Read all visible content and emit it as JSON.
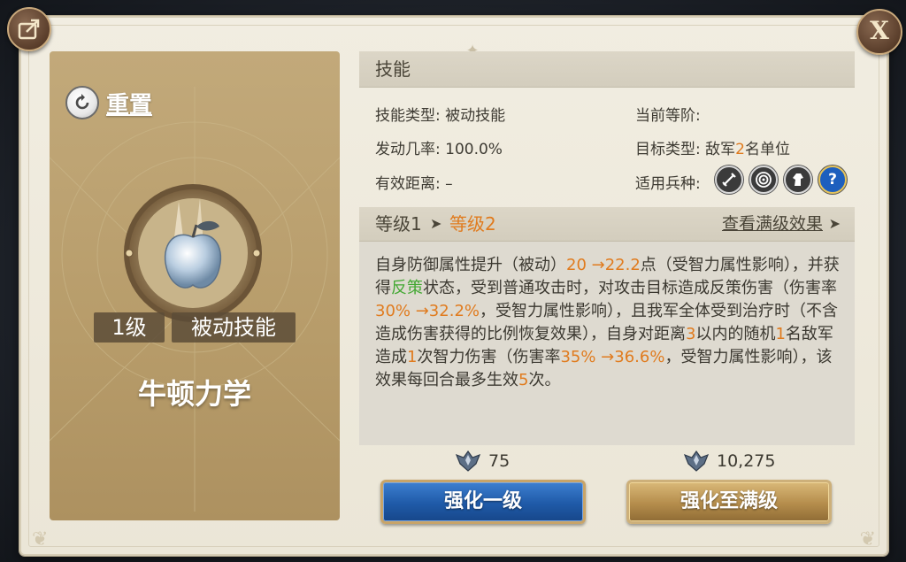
{
  "header": {
    "title": "技能"
  },
  "actions": {
    "share_icon": "share-export-icon",
    "close_label": "X"
  },
  "skill": {
    "reset_label": "重置",
    "level_tag": "1级",
    "type_tag": "被动技能",
    "name": "牛顿力学",
    "emblem_icon": "silver-apple-icon"
  },
  "info": {
    "type_label": "技能类型:",
    "type_value": "被动技能",
    "rank_label": "当前等阶:",
    "rank_value": "",
    "chance_label": "发动几率:",
    "chance_value": "100.0%",
    "target_label": "目标类型:",
    "target_prefix": "敌军",
    "target_count": "2",
    "target_suffix": "名单位",
    "range_label": "有效距离:",
    "range_value": "–",
    "troops_label": "适用兵种:",
    "troop_icons": [
      "sword-icon",
      "target-icon",
      "horse-icon",
      "help-icon"
    ]
  },
  "levels": {
    "current": "等级1",
    "next": "等级2",
    "view_max": "查看满级效果"
  },
  "description": {
    "p1": "自身防御属性提升（被动）",
    "v1": "20 →22.2",
    "p2": "点（受智力属性影响），并获得",
    "kw": "反策",
    "p3": "状态，受到普通攻击时，对攻击目标造成反策伤害（伤害率",
    "v2": "30% →32.2%",
    "p4": "，受智力属性影响），且我军全体受到治疗时（不含造成伤害获得的比例恢复效果），自身对距离",
    "v3": "3",
    "p5": "以内的随机",
    "v4": "1",
    "p6": "名敌军造成",
    "v5": "1",
    "p7": "次智力伤害（伤害率",
    "v6": "35% →36.6%",
    "p8": "，受智力属性影响），该效果每回合最多生效",
    "v7": "5",
    "p9": "次。"
  },
  "costs": {
    "upgrade_cost": "75",
    "max_cost": "10,275",
    "cost_icon": "skill-book-crest-icon"
  },
  "buttons": {
    "upgrade_one": "强化一级",
    "upgrade_max": "强化至满级"
  },
  "colors": {
    "highlight": "#e07b1e",
    "keyword": "#43a833",
    "upgrade_button": "#1f5aa8",
    "max_button": "#b58d4c"
  }
}
